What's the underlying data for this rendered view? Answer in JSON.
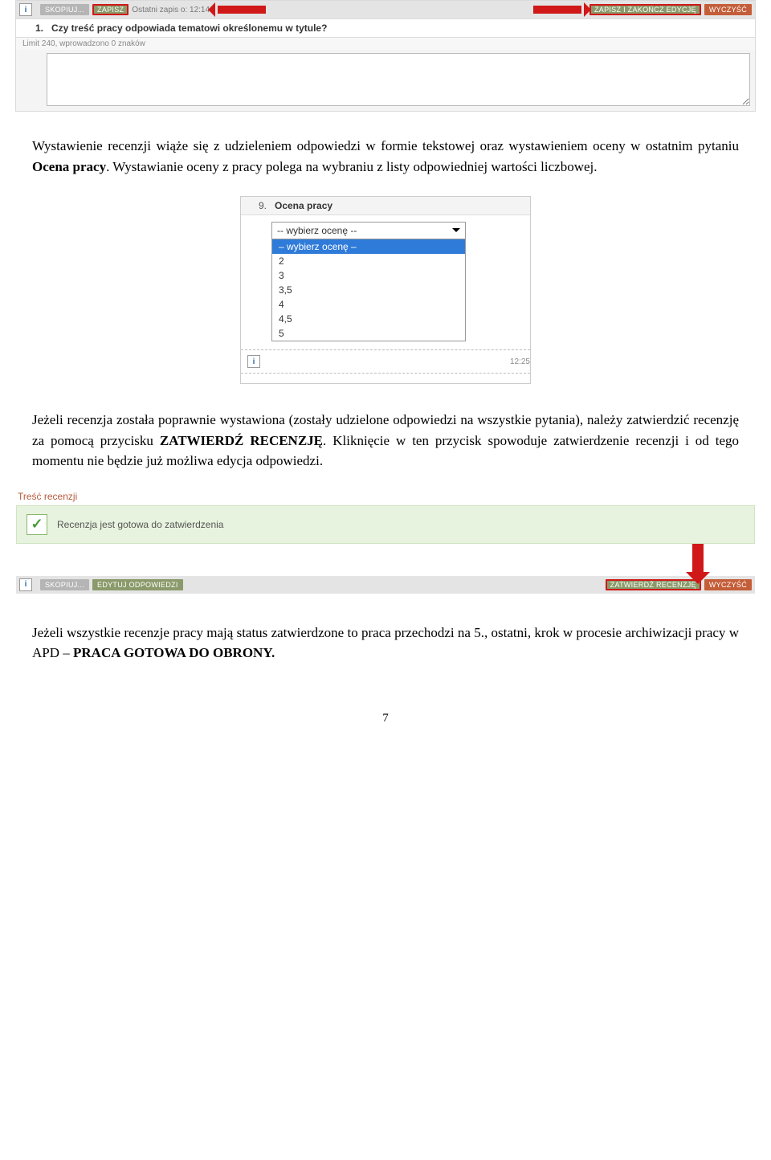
{
  "shot1": {
    "toolbar": {
      "btn_skopiuj": "SKOPIUJ...",
      "btn_zapisz": "ZAPISZ",
      "auto_note_prefix": "Ostatni zapis o:",
      "auto_note_time": "12:14",
      "btn_zapisz_zakoncz": "ZAPISZ I ZAKOŃCZ EDYCJĘ",
      "btn_wyczysc": "WYCZYŚĆ"
    },
    "question_number": "1.",
    "question_text": "Czy treść pracy odpowiada tematowi określonemu w tytule?",
    "limit_text": "Limit 240, wprowadzono 0 znaków"
  },
  "para1_parts": {
    "a": "Wystawienie recenzji wiąże się z udzieleniem odpowiedzi w formie tekstowej oraz wystawieniem oceny w ostatnim pytaniu ",
    "b_bold": "Ocena pracy",
    "c": ". Wystawianie oceny z pracy polega na wybraniu z listy odpowiedniej wartości liczbowej."
  },
  "shot2": {
    "number": "9.",
    "title": "Ocena pracy",
    "placeholder": "-- wybierz ocenę --",
    "selected_label": "– wybierz ocenę –",
    "options": [
      "2",
      "3",
      "3,5",
      "4",
      "4,5",
      "5"
    ],
    "time_note": "12:25"
  },
  "para2_parts": {
    "a": "Jeżeli recenzja została poprawnie wystawiona (zostały udzielone odpowiedzi na wszystkie pytania), należy zatwierdzić recenzję za pomocą przycisku ",
    "b_bold": "ZATWIERDŹ RECENZJĘ",
    "c": ". Kliknięcie w ten przycisk spowoduje zatwierdzenie recenzji i od tego momentu nie będzie już możliwa edycja odpowiedzi."
  },
  "shot3": {
    "section_title": "Treść recenzji",
    "status_text": "Recenzja jest gotowa do zatwierdzenia",
    "btn_skopiuj": "SKOPIUJ...",
    "btn_edytuj": "EDYTUJ ODPOWIEDZI",
    "btn_zatwierdz": "ZATWIERDŹ RECENZJĘ",
    "btn_wyczysc": "WYCZYŚĆ"
  },
  "para3_parts": {
    "a": "Jeżeli wszystkie recenzje pracy mają status zatwierdzone to praca przechodzi na 5., ostatni, krok w procesie archiwizacji pracy w APD – ",
    "b_bold": "PRACA GOTOWA DO OBRONY."
  },
  "page_number": "7"
}
